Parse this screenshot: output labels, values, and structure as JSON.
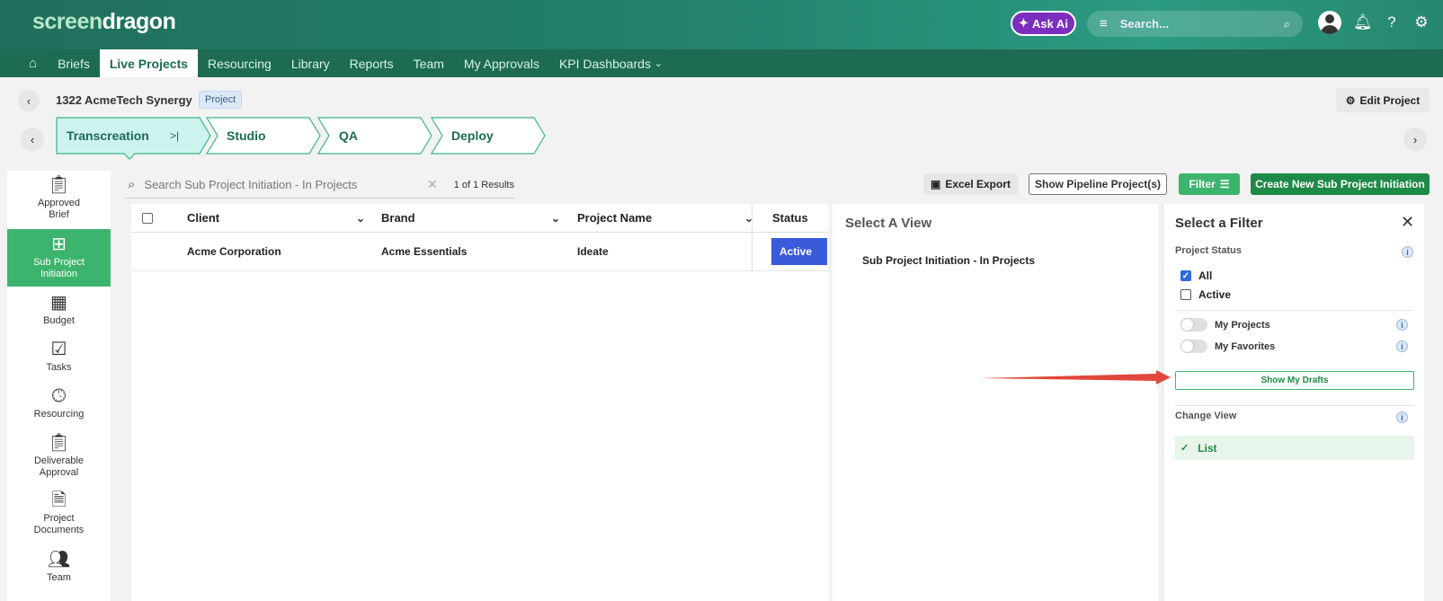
{
  "app": {
    "logo_part1": "screen",
    "logo_part2": "dragon",
    "ask_ai": "Ask Ai",
    "search_placeholder": "Search..."
  },
  "nav": {
    "items": [
      "Briefs",
      "Live Projects",
      "Resourcing",
      "Library",
      "Reports",
      "Team",
      "My Approvals",
      "KPI Dashboards"
    ],
    "active": "Live Projects"
  },
  "project": {
    "title": "1322 AcmeTech Synergy",
    "badge": "Project",
    "edit_label": "Edit Project"
  },
  "stages": [
    "Transcreation",
    "Studio",
    "QA",
    "Deploy"
  ],
  "sidebar": {
    "items": [
      {
        "label": "Approved\nBrief",
        "icon": "document-check-icon"
      },
      {
        "label": "Sub Project\nInitiation",
        "icon": "hierarchy-icon"
      },
      {
        "label": "Budget",
        "icon": "calculator-icon"
      },
      {
        "label": "Tasks",
        "icon": "calendar-check-icon"
      },
      {
        "label": "Resourcing",
        "icon": "clock-icon"
      },
      {
        "label": "Deliverable\nApproval",
        "icon": "document-checklist-icon"
      },
      {
        "label": "Project\nDocuments",
        "icon": "document-icon"
      },
      {
        "label": "Team",
        "icon": "people-icon"
      }
    ],
    "active_index": 1
  },
  "toolbar": {
    "search_placeholder": "Search  Sub Project Initiation - In Projects",
    "results": "1 of 1 Results",
    "excel_export": "Excel Export",
    "show_pipeline": "Show Pipeline Project(s)",
    "filter": "Filter",
    "create_new": "Create New Sub Project Initiation"
  },
  "table": {
    "columns": [
      "Client",
      "Brand",
      "Project Name",
      "Status"
    ],
    "rows": [
      {
        "client": "Acme Corporation",
        "brand": "Acme Essentials",
        "project_name": "Ideate",
        "status": "Active"
      }
    ]
  },
  "view_panel": {
    "title": "Select A View",
    "items": [
      "Sub Project Initiation - In Projects"
    ]
  },
  "filter_panel": {
    "title": "Select a Filter",
    "project_status_label": "Project Status",
    "status_options": [
      {
        "label": "All",
        "checked": true
      },
      {
        "label": "Active",
        "checked": false
      }
    ],
    "toggles": [
      {
        "label": "My Projects",
        "on": false
      },
      {
        "label": "My Favorites",
        "on": false
      }
    ],
    "show_drafts": "Show My Drafts",
    "change_view_label": "Change View",
    "view_option": "List"
  },
  "colors": {
    "brand_green": "#1c6b52",
    "accent_green": "#3db46d",
    "dark_green": "#1e8a47",
    "status_blue": "#3a5bd9",
    "annotation_red": "#e0473a"
  }
}
